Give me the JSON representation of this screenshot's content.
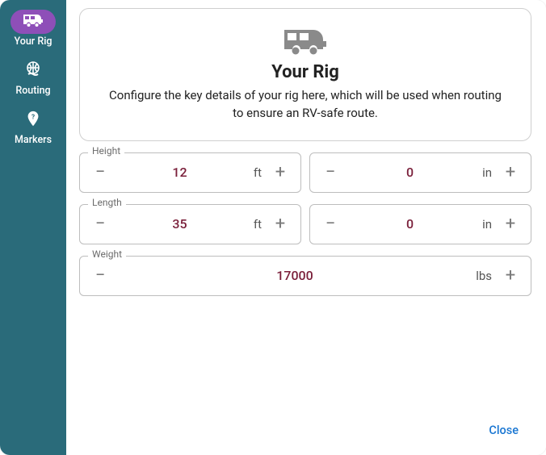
{
  "sidebar": {
    "items": [
      {
        "label": "Your Rig",
        "icon": "rv-icon",
        "active": true
      },
      {
        "label": "Routing",
        "icon": "globe-hand-icon",
        "active": false
      },
      {
        "label": "Markers",
        "icon": "pin-icon",
        "active": false
      }
    ]
  },
  "hero": {
    "title": "Your Rig",
    "description": "Configure the key details of your rig here, which will be used when routing to ensure an RV-safe route."
  },
  "fields": {
    "height": {
      "label": "Height",
      "primary": {
        "value": "12",
        "unit": "ft"
      },
      "secondary": {
        "value": "0",
        "unit": "in"
      }
    },
    "length": {
      "label": "Length",
      "primary": {
        "value": "35",
        "unit": "ft"
      },
      "secondary": {
        "value": "0",
        "unit": "in"
      }
    },
    "weight": {
      "label": "Weight",
      "primary": {
        "value": "17000",
        "unit": "lbs"
      }
    }
  },
  "footer": {
    "close_label": "Close"
  },
  "glyphs": {
    "minus": "−",
    "plus": "+"
  }
}
